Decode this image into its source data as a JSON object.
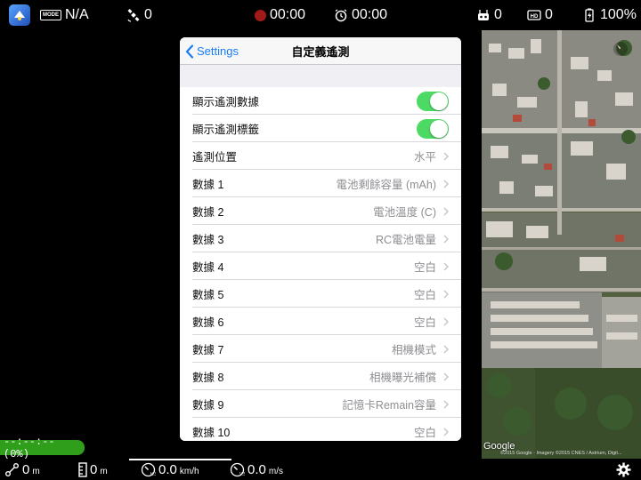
{
  "topbar": {
    "mode_badge": "MODE",
    "flight_mode": "N/A",
    "satellites": "0",
    "record_time": "00:00",
    "timer": "00:00",
    "rc_signal": "0",
    "hd_signal": "0",
    "battery": "100%"
  },
  "panel": {
    "back_label": "Settings",
    "title": "自定義遙測",
    "rows": [
      {
        "label": "顯示遙測數據",
        "type": "toggle",
        "on": true
      },
      {
        "label": "顯示遙測標籤",
        "type": "toggle",
        "on": true
      },
      {
        "label": "遙測位置",
        "value": "水平"
      },
      {
        "label": "數據 1",
        "value": "電池剩餘容量 (mAh)"
      },
      {
        "label": "數據 2",
        "value": "電池溫度 (C)"
      },
      {
        "label": "數據 3",
        "value": "RC電池電量"
      },
      {
        "label": "數據 4",
        "value": "空白"
      },
      {
        "label": "數據 5",
        "value": "空白"
      },
      {
        "label": "數據 6",
        "value": "空白"
      },
      {
        "label": "數據 7",
        "value": "相機模式"
      },
      {
        "label": "數據 8",
        "value": "相機曝光補償"
      },
      {
        "label": "數據 9",
        "value": "記憶卡Remain容量"
      },
      {
        "label": "數據 10",
        "value": "空白"
      }
    ]
  },
  "battery_pill": "--:--:-- (0%)",
  "map": {
    "google_label": "Google",
    "credit": "©2015 Google · Imagery ©2015 CNES / Astrium, Digit..."
  },
  "bottombar": {
    "distance": "0",
    "distance_unit": "m",
    "altitude": "0",
    "altitude_unit": "m",
    "h_speed": "0.0",
    "h_speed_unit": "km/h",
    "v_speed": "0.0",
    "v_speed_unit": "m/s"
  },
  "colors": {
    "toggle_on": "#4cd964",
    "link_blue": "#1a7cf5",
    "battery_green": "#2e9e1b",
    "record_red": "#a11a1a"
  }
}
